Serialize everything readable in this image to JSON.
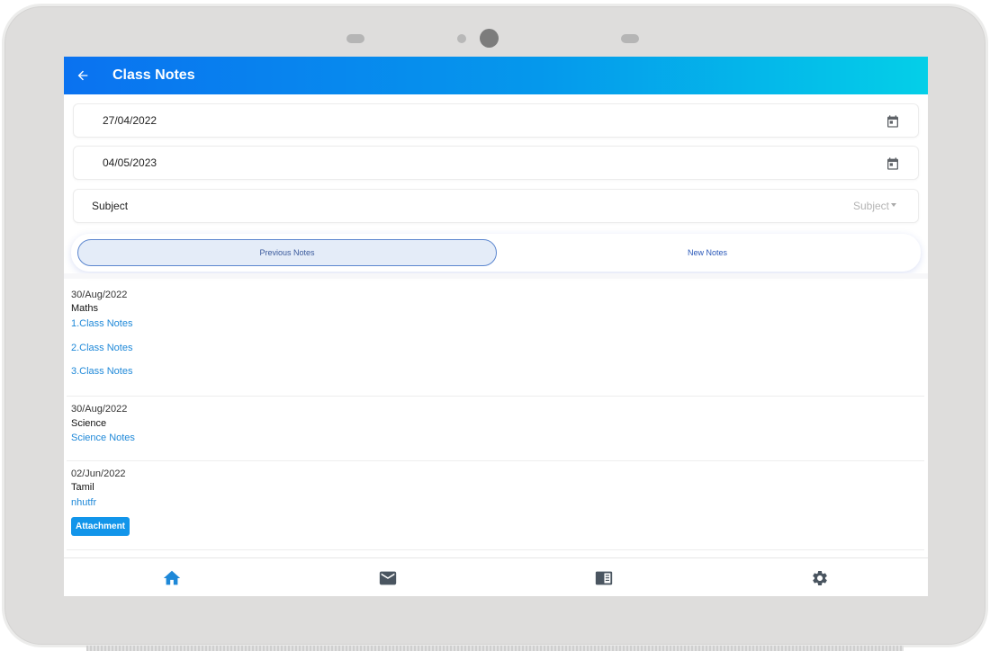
{
  "app": {
    "title": "Class Notes"
  },
  "filters": {
    "from_date": "27/04/2022",
    "to_date": "04/05/2023",
    "subject_label": "Subject",
    "subject_value": "Subject"
  },
  "tabs": [
    {
      "label": "Previous Notes",
      "active": true
    },
    {
      "label": "New Notes",
      "active": false
    }
  ],
  "notes": [
    {
      "date": "30/Aug/2022",
      "subject": "Maths",
      "links": [
        "1.Class Notes",
        "2.Class Notes",
        "3.Class Notes"
      ]
    },
    {
      "date": "30/Aug/2022",
      "subject": "Science",
      "links": [
        "Science Notes"
      ]
    },
    {
      "date": "02/Jun/2022",
      "subject": "Tamil",
      "links": [
        "nhutfr"
      ],
      "attachment_label": "Attachment"
    }
  ],
  "bottom_nav": [
    {
      "icon": "home-icon",
      "color": "#1e88d8",
      "active": true
    },
    {
      "icon": "mail-icon",
      "color": "#4a5560"
    },
    {
      "icon": "notebook-icon",
      "color": "#4a5560"
    },
    {
      "icon": "gear-icon",
      "color": "#4a5560"
    }
  ],
  "colors": {
    "appbar_start": "#0a72f0",
    "appbar_end": "#04cfe8",
    "link": "#1e88d8",
    "attachment": "#1295ea"
  }
}
